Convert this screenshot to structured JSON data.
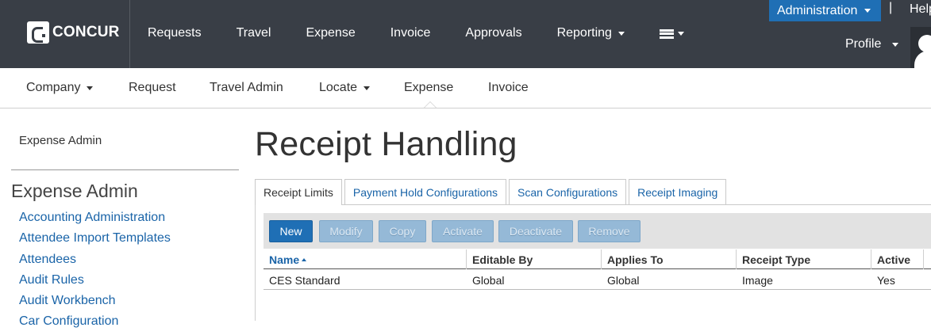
{
  "app": {
    "logo_text": "CONCUR",
    "colors": {
      "topbar": "#393e46",
      "accent": "#1f6fb5",
      "link": "#1a64a8"
    }
  },
  "topnav": {
    "items": [
      {
        "label": "Requests",
        "dropdown": false
      },
      {
        "label": "Travel",
        "dropdown": false
      },
      {
        "label": "Expense",
        "dropdown": false
      },
      {
        "label": "Invoice",
        "dropdown": false
      },
      {
        "label": "Approvals",
        "dropdown": false
      },
      {
        "label": "Reporting",
        "dropdown": true
      }
    ],
    "more_icon": "hamburger-menu-icon",
    "administration_label": "Administration",
    "pipe": "|",
    "help_label": "Help",
    "profile_label": "Profile"
  },
  "subnav": {
    "items": [
      {
        "label": "Company",
        "dropdown": true
      },
      {
        "label": "Request",
        "dropdown": false
      },
      {
        "label": "Travel Admin",
        "dropdown": false
      },
      {
        "label": "Locate",
        "dropdown": true
      },
      {
        "label": "Expense",
        "dropdown": false,
        "active": true
      },
      {
        "label": "Invoice",
        "dropdown": false
      }
    ]
  },
  "sidebar": {
    "heading": "Expense Admin",
    "title": "Expense Admin",
    "links": [
      "Accounting Administration",
      "Attendee Import Templates",
      "Attendees",
      "Audit Rules",
      "Audit Workbench",
      "Car Configuration"
    ]
  },
  "main": {
    "title": "Receipt Handling",
    "tabs": [
      {
        "label": "Receipt Limits",
        "active": true
      },
      {
        "label": "Payment Hold Configurations",
        "active": false
      },
      {
        "label": "Scan Configurations",
        "active": false
      },
      {
        "label": "Receipt Imaging",
        "active": false
      }
    ],
    "toolbar": {
      "new": "New",
      "modify": "Modify",
      "copy": "Copy",
      "activate": "Activate",
      "deactivate": "Deactivate",
      "remove": "Remove"
    },
    "grid": {
      "columns": [
        "Name",
        "Editable By",
        "Applies To",
        "Receipt Type",
        "Active"
      ],
      "sorted_column": "Name",
      "sort_direction": "ascending",
      "rows": [
        [
          "CES Standard",
          "Global",
          "Global",
          "Image",
          "Yes"
        ]
      ]
    }
  }
}
